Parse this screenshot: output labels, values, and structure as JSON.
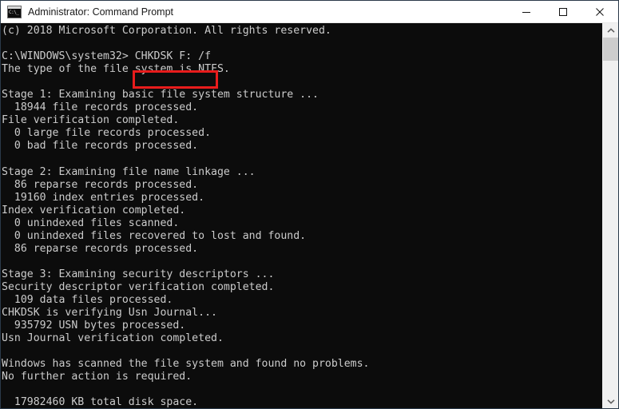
{
  "window": {
    "title": "Administrator: Command Prompt",
    "icon": "command-prompt-icon",
    "background_color": "#0c0c0c",
    "titlebar_color": "#ffffff",
    "border_color": "#2b3a4a"
  },
  "titlebar_buttons": {
    "minimize": "minimize-icon",
    "maximize": "maximize-icon",
    "close": "close-icon"
  },
  "console": {
    "text_color": "#cccccc",
    "font_size_px": 13,
    "lines": [
      "(c) 2018 Microsoft Corporation. All rights reserved.",
      "",
      "C:\\WINDOWS\\system32> CHKDSK F: /f",
      "The type of the file system is NTFS.",
      "",
      "Stage 1: Examining basic file system structure ...",
      "  18944 file records processed.",
      "File verification completed.",
      "  0 large file records processed.",
      "  0 bad file records processed.",
      "",
      "Stage 2: Examining file name linkage ...",
      "  86 reparse records processed.",
      "  19160 index entries processed.",
      "Index verification completed.",
      "  0 unindexed files scanned.",
      "  0 unindexed files recovered to lost and found.",
      "  86 reparse records processed.",
      "",
      "Stage 3: Examining security descriptors ...",
      "Security descriptor verification completed.",
      "  109 data files processed.",
      "CHKDSK is verifying Usn Journal...",
      "  935792 USN bytes processed.",
      "Usn Journal verification completed.",
      "",
      "Windows has scanned the file system and found no problems.",
      "No further action is required.",
      "",
      "  17982460 KB total disk space."
    ],
    "prompt": "C:\\WINDOWS\\system32>",
    "typed_command": "CHKDSK F: /f"
  },
  "annotation": {
    "highlight_target": "CHKDSK F: /f",
    "highlight_color": "#e81c1c"
  },
  "scrollbar": {
    "up_arrow": "scroll-up-icon",
    "down_arrow": "scroll-down-icon",
    "thumb_color": "#cdcdcd",
    "track_color": "#f0f0f0"
  }
}
